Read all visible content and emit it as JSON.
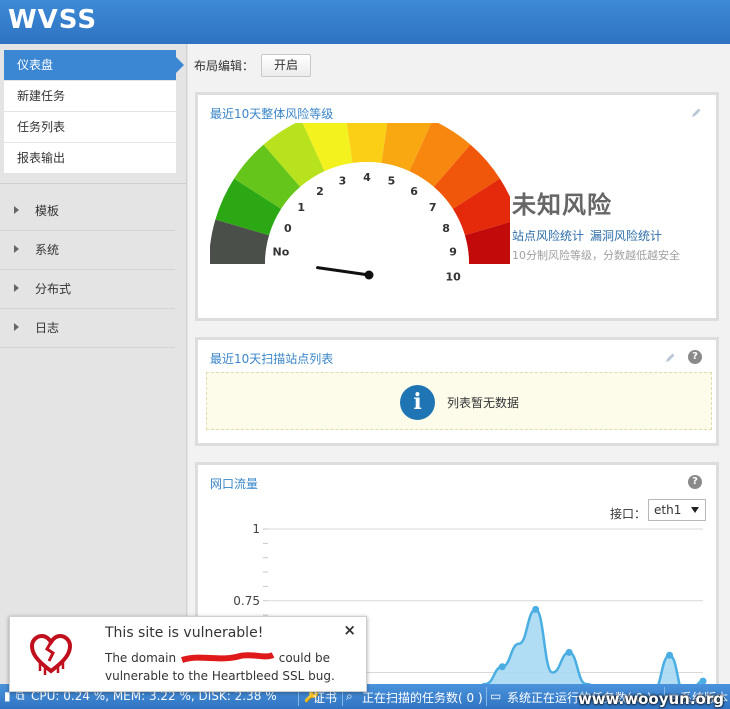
{
  "app": {
    "logo": "WVSS"
  },
  "sidebar": {
    "menu": [
      {
        "label": "仪表盘",
        "active": true
      },
      {
        "label": "新建任务"
      },
      {
        "label": "任务列表"
      },
      {
        "label": "报表输出"
      }
    ],
    "groups": [
      {
        "label": "模板"
      },
      {
        "label": "系统"
      },
      {
        "label": "分布式"
      },
      {
        "label": "日志"
      }
    ]
  },
  "layout": {
    "label": "布局编辑：",
    "button": "开启"
  },
  "risk_panel": {
    "title": "最近10天整体风险等级",
    "risk_level": "未知风险",
    "link_site": "站点风险统计",
    "link_vuln": "漏洞风险统计",
    "note": "10分制风险等级，分数越低越安全",
    "gauge": {
      "ticks": [
        "No",
        "0",
        "1",
        "2",
        "3",
        "4",
        "5",
        "6",
        "7",
        "8",
        "9",
        "10"
      ],
      "segment_colors": [
        "#4a4f4a",
        "#2ca814",
        "#66c51b",
        "#b8e21d",
        "#f3f21e",
        "#fbcf15",
        "#f9a812",
        "#f7870f",
        "#f0570a",
        "#e42a0b",
        "#c20a0a"
      ],
      "value": null
    }
  },
  "sites_panel": {
    "title": "最近10天扫描站点列表",
    "empty_text": "列表暂无数据"
  },
  "traffic_panel": {
    "title": "网口流量",
    "interface_label": "接口：",
    "interface_value": "eth1",
    "chart_data": {
      "type": "area",
      "ylim": [
        0,
        1
      ],
      "y_ticks": [
        "1",
        "0.75"
      ],
      "grid": true,
      "color": "#4aaee3",
      "fill": "#a8d9f3",
      "values": [
        0.55,
        0.42,
        0.27,
        0.25,
        0.28,
        0.31,
        0.4,
        0.45,
        0.4,
        0.36,
        0.38,
        0.37,
        0.41,
        0.46,
        0.52,
        0.6,
        0.72,
        0.5,
        0.57,
        0.46,
        0.44,
        0.44,
        0.43,
        0.43,
        0.56,
        0.41,
        0.47
      ]
    }
  },
  "toast": {
    "title": "This site is vulnerable!",
    "body_pre": "The domain",
    "body_post": "could be vulnerable to the Heartbleed SSL bug.",
    "close": "×"
  },
  "statusbar": {
    "cpu": "CPU: 0.24 %, MEM: 3.22 %, DISK: 2.38 %",
    "cert": "证书",
    "scanning": "正在扫描的任务数( 0 )",
    "running": "系统正在运行的任务数( 0 )",
    "version": "系统版本"
  },
  "watermark": "www.wooyun.org"
}
